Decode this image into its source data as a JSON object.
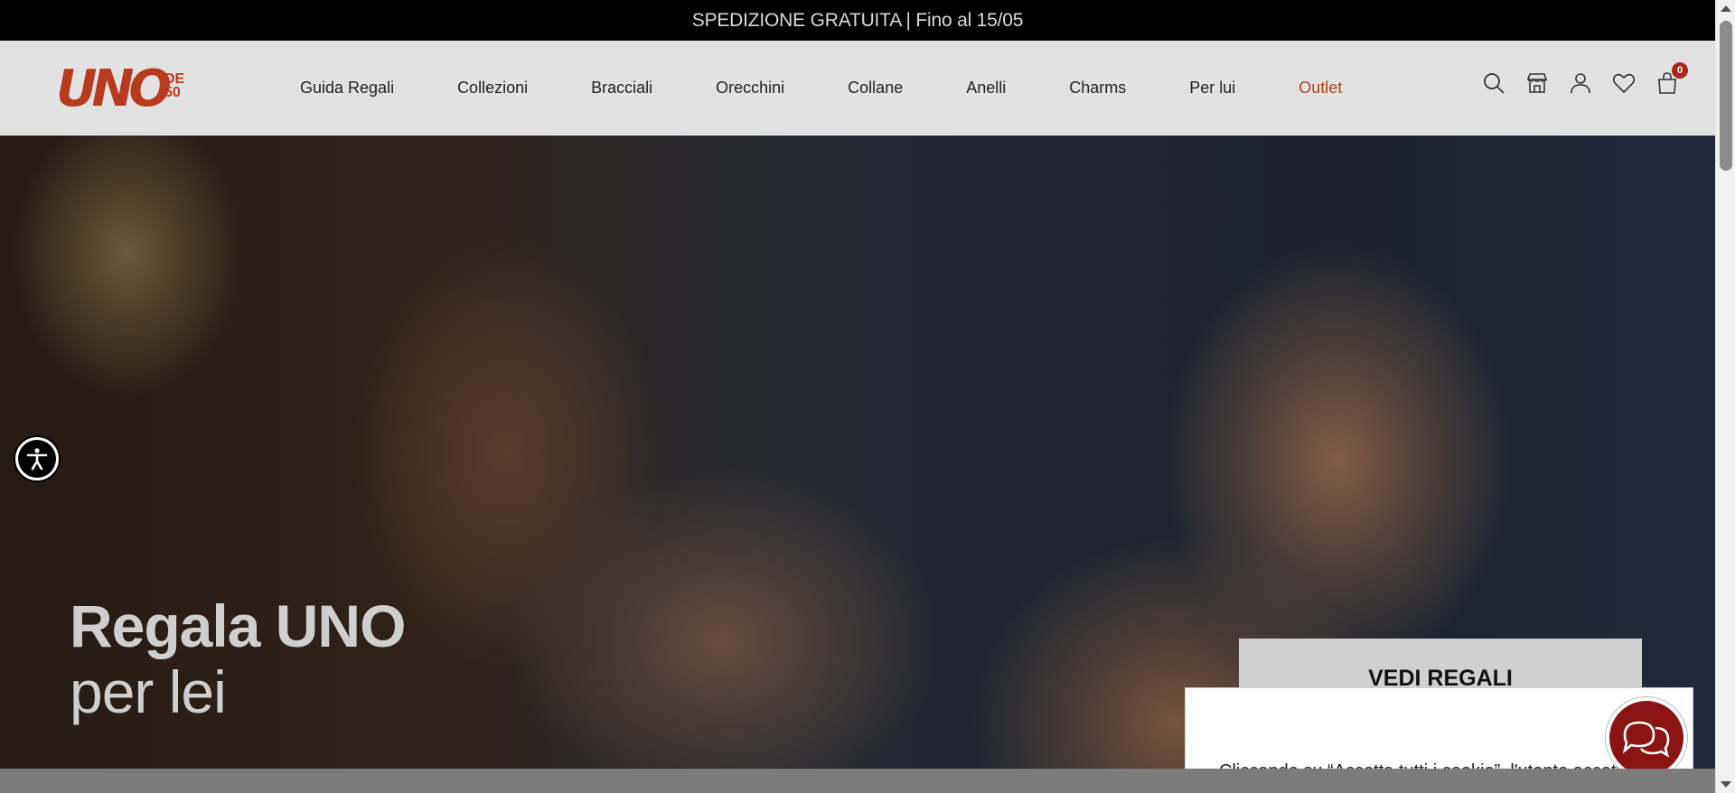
{
  "announcement": {
    "text": "SPEDIZIONE GRATUITA | Fino al 15/05"
  },
  "logo": {
    "main": "UNO",
    "line1": "DE",
    "line2": "50"
  },
  "nav": {
    "items": [
      {
        "label": "Guida Regali"
      },
      {
        "label": "Collezioni"
      },
      {
        "label": "Bracciali"
      },
      {
        "label": "Orecchini"
      },
      {
        "label": "Collane"
      },
      {
        "label": "Anelli"
      },
      {
        "label": "Charms"
      },
      {
        "label": "Per lui"
      },
      {
        "label": "Outlet"
      }
    ]
  },
  "header_icons": [
    {
      "name": "search-icon"
    },
    {
      "name": "store-icon"
    },
    {
      "name": "account-icon"
    },
    {
      "name": "wishlist-heart-icon"
    },
    {
      "name": "cart-bag-icon"
    }
  ],
  "cart": {
    "count": "0"
  },
  "hero": {
    "title": "Regala UNO",
    "subtitle": "per lei",
    "button_label": "VEDI REGALI"
  },
  "cookie": {
    "text": "Cliccando su “Accetta tutti i cookie”, l'utente accetta di memorizzare i cookie sul dispositivo per"
  },
  "colors": {
    "brand": "#b83a1f",
    "outlet": "#a8461e",
    "chat": "#8b1414",
    "topbar": "#000000"
  }
}
